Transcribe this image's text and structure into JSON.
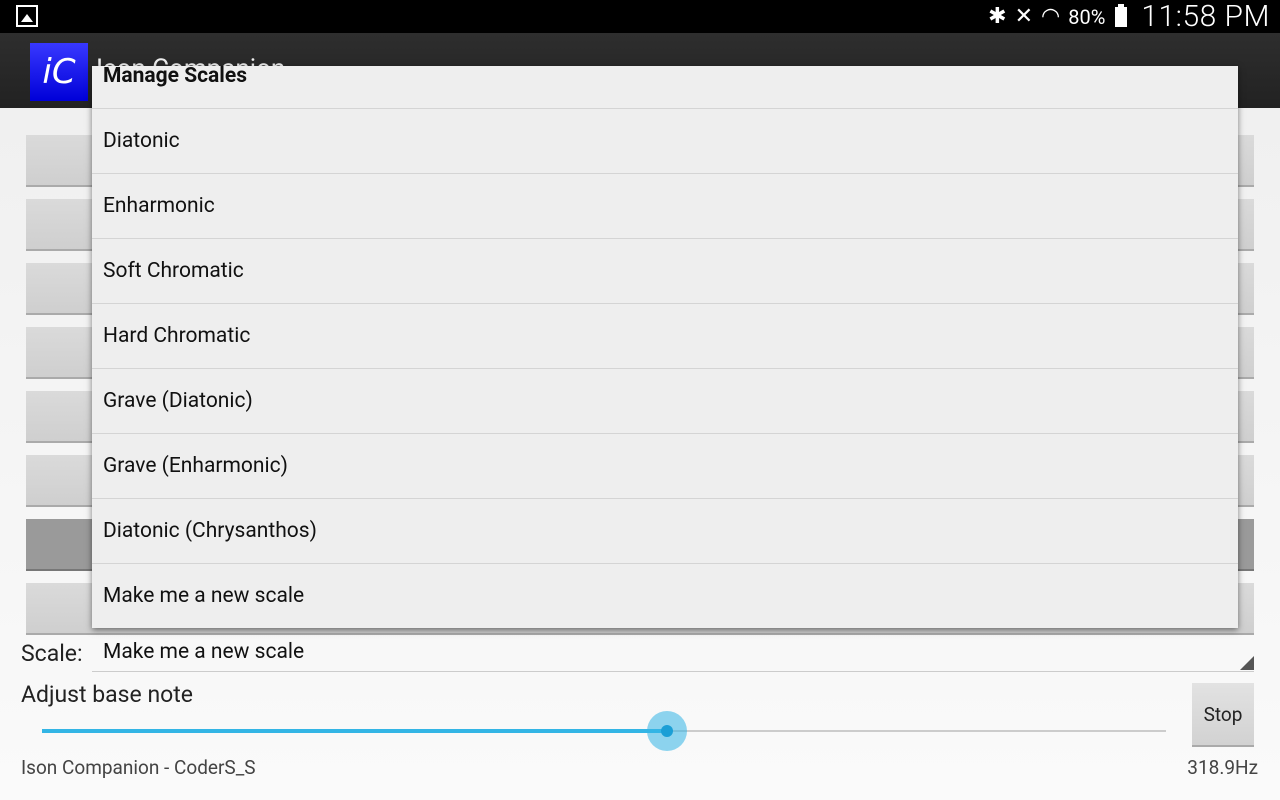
{
  "status_bar": {
    "battery": "80%",
    "clock": "11:58 PM",
    "icons": [
      "gallery-icon",
      "bluetooth-icon",
      "mute-icon",
      "wifi-icon",
      "battery-icon"
    ]
  },
  "action_bar": {
    "app_icon_text": "iC",
    "title": "Ison Companion"
  },
  "main": {
    "scale_label": "Scale:",
    "scale_value": "Make me a new scale",
    "adjust_label": "Adjust base note",
    "slider_fraction": 0.556,
    "stop_label": "Stop",
    "footer_left": "Ison Companion - CoderS_S",
    "footer_right": "318.9Hz"
  },
  "dropdown": {
    "header": "Manage Scales",
    "items": [
      "Diatonic",
      "Enharmonic",
      "Soft Chromatic",
      "Hard Chromatic",
      "Grave (Diatonic)",
      "Grave (Enharmonic)",
      "Diatonic (Chrysanthos)",
      "Make me a new scale"
    ]
  },
  "colors": {
    "accent": "#33b5e5",
    "app_icon": "#0000e0",
    "status_bar": "#000000"
  }
}
